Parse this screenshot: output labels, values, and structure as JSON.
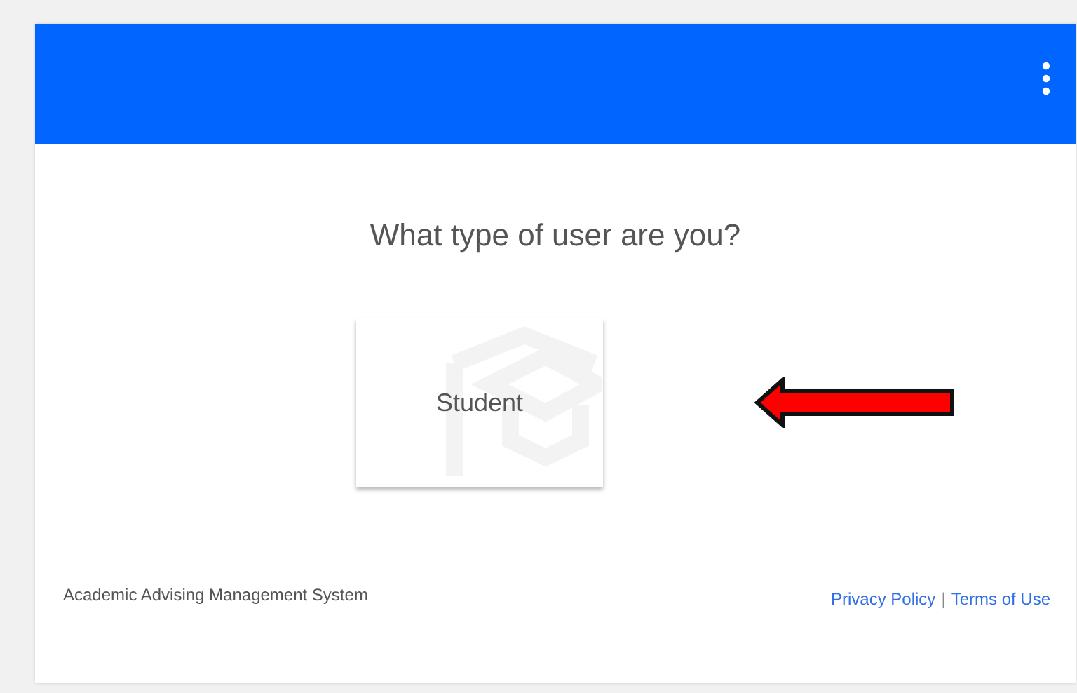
{
  "question": "What type of user are you?",
  "options": [
    {
      "label": "Student"
    }
  ],
  "footer": {
    "system_name": "Academic Advising Management System",
    "links": [
      "Privacy Policy",
      "Terms of Use"
    ],
    "separator": "|"
  }
}
